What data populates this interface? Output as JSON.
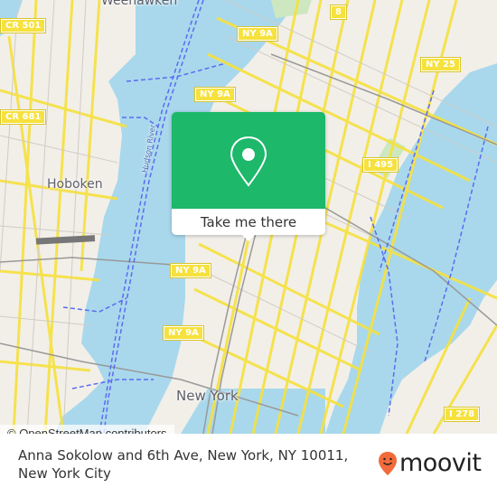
{
  "map": {
    "place_labels": [
      {
        "id": "weehawken",
        "text": "Weehawken"
      },
      {
        "id": "hoboken",
        "text": "Hoboken"
      },
      {
        "id": "new-york",
        "text": "New York"
      },
      {
        "id": "hudson-river",
        "text": "Hudson River"
      }
    ],
    "road_shields": [
      {
        "id": "cr501",
        "text": "CR 501"
      },
      {
        "id": "cr681",
        "text": "CR 681"
      },
      {
        "id": "ny9a-1",
        "text": "NY 9A"
      },
      {
        "id": "ny9a-2",
        "text": "NY 9A"
      },
      {
        "id": "ny9a-3",
        "text": "NY 9A"
      },
      {
        "id": "ny9a-4",
        "text": "NY 9A"
      },
      {
        "id": "ny9a-5",
        "text": "NY 9A"
      },
      {
        "id": "route8",
        "text": "8"
      },
      {
        "id": "ny25",
        "text": "NY 25"
      },
      {
        "id": "i495",
        "text": "I 495"
      },
      {
        "id": "i278",
        "text": "I 278"
      }
    ],
    "attribution": "© OpenStreetMap contributors",
    "colors": {
      "water": "#a9d8ec",
      "land": "#f2efe9",
      "road": "#f6e13d",
      "ferry": "#5a6cf0",
      "rail": "#999999"
    }
  },
  "popup": {
    "button_label": "Take me there",
    "icon": "location-pin-icon",
    "color": "#1db86a"
  },
  "footer": {
    "address": "Anna Sokolow and 6th Ave, New York, NY 10011, New York City",
    "brand": "moovit",
    "brand_color": "#f26b3a"
  }
}
